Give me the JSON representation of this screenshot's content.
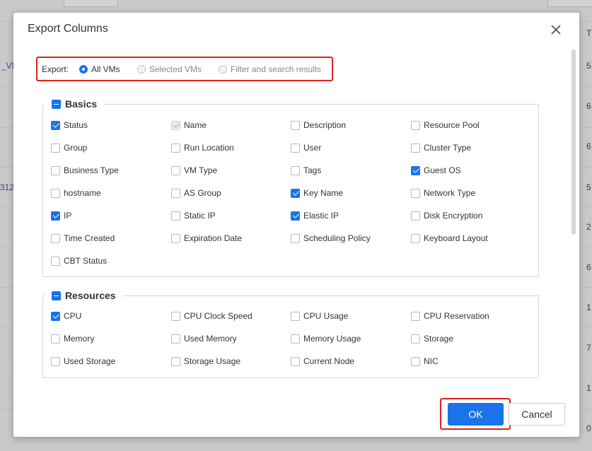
{
  "background": {
    "left_cells": [
      "_VM",
      "312"
    ],
    "right_cells": [
      "T",
      "5",
      "6",
      "6",
      "5",
      "2",
      "6",
      "1",
      "7",
      "1",
      "0"
    ]
  },
  "dialog": {
    "title": "Export Columns",
    "export": {
      "label": "Export:",
      "options": [
        {
          "label": "All VMs",
          "selected": true,
          "disabled": false
        },
        {
          "label": "Selected VMs",
          "selected": false,
          "disabled": true
        },
        {
          "label": "Filter and search results",
          "selected": false,
          "disabled": true
        }
      ]
    },
    "sections": [
      {
        "title": "Basics",
        "items": [
          {
            "label": "Status",
            "checked": true
          },
          {
            "label": "Name",
            "checked": true,
            "disabled": true
          },
          {
            "label": "Description",
            "checked": false
          },
          {
            "label": "Resource Pool",
            "checked": false
          },
          {
            "label": "Group",
            "checked": false
          },
          {
            "label": "Run Location",
            "checked": false
          },
          {
            "label": "User",
            "checked": false
          },
          {
            "label": "Cluster Type",
            "checked": false
          },
          {
            "label": "Business Type",
            "checked": false
          },
          {
            "label": "VM Type",
            "checked": false
          },
          {
            "label": "Tags",
            "checked": false
          },
          {
            "label": "Guest OS",
            "checked": true
          },
          {
            "label": "hostname",
            "checked": false
          },
          {
            "label": "AS Group",
            "checked": false
          },
          {
            "label": "Key Name",
            "checked": true
          },
          {
            "label": "Network Type",
            "checked": false
          },
          {
            "label": "IP",
            "checked": true
          },
          {
            "label": "Static IP",
            "checked": false
          },
          {
            "label": "Elastic IP",
            "checked": true
          },
          {
            "label": "Disk Encryption",
            "checked": false
          },
          {
            "label": "Time Created",
            "checked": false
          },
          {
            "label": "Expiration Date",
            "checked": false
          },
          {
            "label": "Scheduling Policy",
            "checked": false
          },
          {
            "label": "Keyboard Layout",
            "checked": false
          },
          {
            "label": "CBT Status",
            "checked": false
          }
        ]
      },
      {
        "title": "Resources",
        "items": [
          {
            "label": "CPU",
            "checked": true
          },
          {
            "label": "CPU Clock Speed",
            "checked": false
          },
          {
            "label": "CPU Usage",
            "checked": false
          },
          {
            "label": "CPU Reservation",
            "checked": false
          },
          {
            "label": "Memory",
            "checked": false
          },
          {
            "label": "Used Memory",
            "checked": false
          },
          {
            "label": "Memory Usage",
            "checked": false
          },
          {
            "label": "Storage",
            "checked": false
          },
          {
            "label": "Used Storage",
            "checked": false
          },
          {
            "label": "Storage Usage",
            "checked": false
          },
          {
            "label": "Current Node",
            "checked": false
          },
          {
            "label": "NIC",
            "checked": false
          }
        ]
      }
    ],
    "buttons": {
      "ok": "OK",
      "cancel": "Cancel"
    }
  }
}
